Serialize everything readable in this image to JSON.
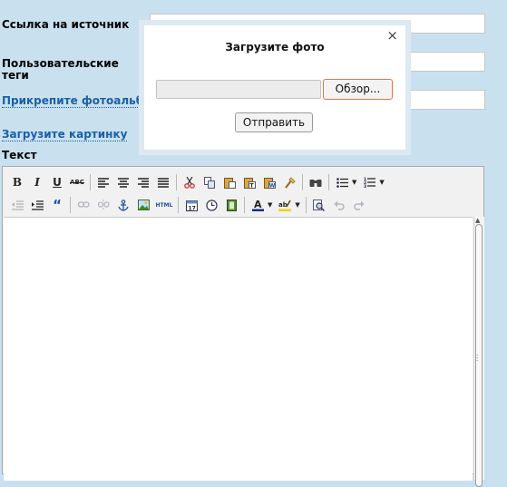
{
  "form": {
    "source_link_label": "Ссылка на источник",
    "user_tags_label": "Пользовательские теги",
    "attach_album_link": "Прикрепите фотоальбо",
    "upload_picture_link": "Загрузите картинку",
    "text_label": "Текст"
  },
  "toolbar": {
    "bold": "B",
    "italic": "I",
    "underline": "U",
    "strikethrough": "ABC",
    "html": "HTML",
    "blockquote": "“"
  },
  "dialog": {
    "title": "Загрузите фото",
    "close": "×",
    "browse_label": "Обзор...",
    "submit_label": "Отправить"
  },
  "colors": {
    "page_bg": "#c9e1ef",
    "link": "#1a5fa8",
    "browse_border": "#e0774a"
  }
}
